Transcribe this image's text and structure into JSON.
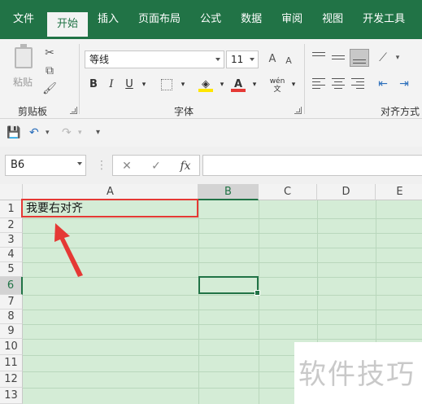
{
  "ribbon_tabs": [
    {
      "label": "文件",
      "active": false
    },
    {
      "label": "开始",
      "active": true
    },
    {
      "label": "插入",
      "active": false
    },
    {
      "label": "页面布局",
      "active": false
    },
    {
      "label": "公式",
      "active": false
    },
    {
      "label": "数据",
      "active": false
    },
    {
      "label": "审阅",
      "active": false
    },
    {
      "label": "视图",
      "active": false
    },
    {
      "label": "开发工具",
      "active": false
    }
  ],
  "clipboard": {
    "paste_label": "粘贴",
    "group_label": "剪贴板"
  },
  "font": {
    "name": "等线",
    "size": "11",
    "group_label": "字体",
    "bold": "B",
    "italic": "I",
    "underline": "U",
    "phonetic": "wén"
  },
  "alignment": {
    "group_label": "对齐方式"
  },
  "formula_bar": {
    "name_box": "B6",
    "fx_label": "fx",
    "formula": ""
  },
  "grid": {
    "columns": [
      "A",
      "B",
      "C",
      "D",
      "E"
    ],
    "selected_column": "B",
    "rows": [
      "1",
      "2",
      "3",
      "4",
      "5",
      "6",
      "7",
      "8",
      "9",
      "10",
      "11",
      "12",
      "13"
    ],
    "selected_row": "6",
    "cells": {
      "A1": "我要右对齐"
    }
  },
  "watermark": "软件技巧",
  "colors": {
    "brand": "#217346",
    "annotation": "#e53935",
    "sheet_bg": "#d4ecd6"
  }
}
